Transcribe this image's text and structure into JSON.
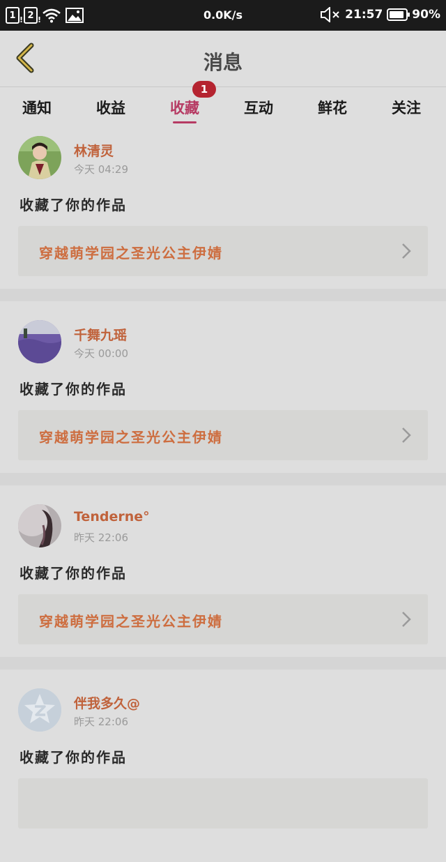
{
  "status_bar": {
    "sim1": "1",
    "sim2": "2",
    "net_speed": "0.0K/s",
    "time": "21:57",
    "battery": "90%",
    "battery_level": 0.9,
    "icons": [
      "sim1-icon",
      "sim2-icon",
      "wifi-icon",
      "gallery-icon",
      "mute-icon",
      "battery-icon"
    ]
  },
  "header": {
    "title": "消息"
  },
  "tabs": [
    {
      "label": "通知"
    },
    {
      "label": "收益"
    },
    {
      "label": "收藏",
      "active": true,
      "badge": "1"
    },
    {
      "label": "互动"
    },
    {
      "label": "鲜花"
    },
    {
      "label": "关注"
    }
  ],
  "feed": [
    {
      "user": "林清灵",
      "time": "今天 04:29",
      "message": "收藏了你的作品",
      "work": "穿越萌学园之圣光公主伊婧"
    },
    {
      "user": "千舞九瑶",
      "time": "今天 00:00",
      "message": "收藏了你的作品",
      "work": "穿越萌学园之圣光公主伊婧"
    },
    {
      "user": "Tenderne°",
      "time": "昨天 22:06",
      "message": "收藏了你的作品",
      "work": "穿越萌学园之圣光公主伊婧"
    },
    {
      "user": "伴我多久@",
      "time": "昨天 22:06",
      "message": "收藏了你的作品",
      "work": ""
    }
  ],
  "colors": {
    "accent": "#b63a63",
    "badge": "#b52430",
    "username": "#c0623b",
    "work_title": "#cd6d3f",
    "background": "#dedede"
  }
}
